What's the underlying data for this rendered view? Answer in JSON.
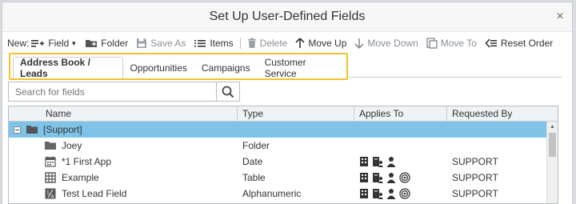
{
  "dialog": {
    "title": "Set Up User-Defined Fields",
    "close_glyph": "×"
  },
  "toolbar": {
    "new_label": "New:",
    "field_label": "Field",
    "folder_label": "Folder",
    "save_as_label": "Save As",
    "items_label": "Items",
    "delete_label": "Delete",
    "move_up_label": "Move Up",
    "move_down_label": "Move Down",
    "move_to_label": "Move To",
    "reset_order_label": "Reset Order"
  },
  "tabs": [
    {
      "label": "Address Book / Leads",
      "active": true
    },
    {
      "label": "Opportunities",
      "active": false
    },
    {
      "label": "Campaigns",
      "active": false
    },
    {
      "label": "Customer Service",
      "active": false
    }
  ],
  "search": {
    "placeholder": "Search for fields"
  },
  "grid": {
    "columns": {
      "name": "Name",
      "type": "Type",
      "applies_to": "Applies To",
      "requested_by": "Requested By"
    },
    "rows": [
      {
        "name": "[Support]",
        "type": "",
        "requested_by": "",
        "icon": "folder-icon",
        "group": true
      },
      {
        "name": "Joey",
        "type": "Folder",
        "requested_by": "",
        "icon": "folder-icon",
        "group": false
      },
      {
        "name": "*1 First App",
        "type": "Date",
        "requested_by": "SUPPORT",
        "icon": "calendar-icon",
        "group": false
      },
      {
        "name": "Example",
        "type": "Table",
        "requested_by": "SUPPORT",
        "icon": "table-icon",
        "group": false
      },
      {
        "name": "Test Lead Field",
        "type": "Alphanumeric",
        "requested_by": "SUPPORT",
        "icon": "alphanumeric-icon",
        "group": false
      }
    ]
  },
  "colors": {
    "highlight": "#f2c12e",
    "selected_row": "#7fc4e8"
  }
}
